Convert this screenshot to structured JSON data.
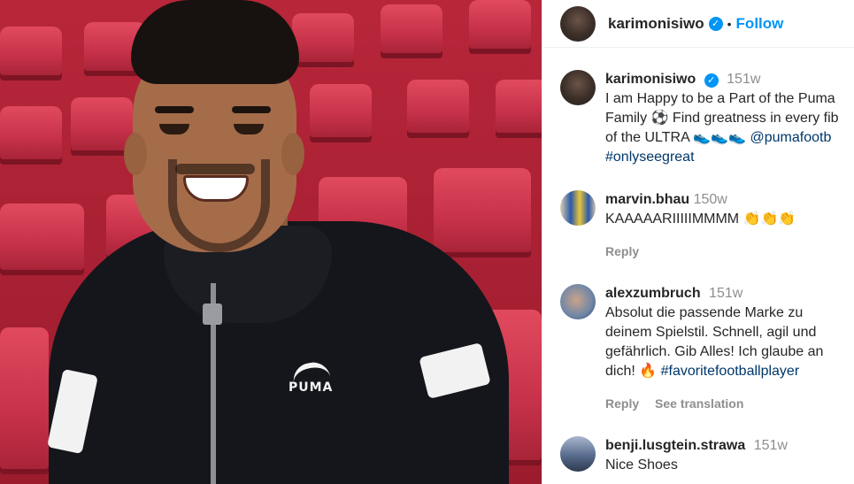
{
  "header": {
    "username": "karimonisiwo",
    "separator": "•",
    "follow_label": "Follow"
  },
  "caption": {
    "username": "karimonisiwo",
    "time": "151w",
    "line1": "I am Happy to be a Part of the Puma",
    "line2": "Family ⚽ Find greatness in every fib",
    "line3_text": "of the ULTRA 👟👟👟 ",
    "line3_link": "@pumafootb",
    "line4_link": "#onlyseegreat"
  },
  "comments": [
    {
      "username": "marvin.bhau",
      "time": "150w",
      "text": "KAAAAARIIIIIMMMM 👏👏👏",
      "reply_label": "Reply"
    },
    {
      "username": "alexzumbruch",
      "time": "151w",
      "line1": "Absolut die passende Marke zu",
      "line2": "deinem Spielstil. Schnell, agil und",
      "line3": "gefährlich. Gib Alles! Ich glaube an",
      "line4_text": "dich! 🔥 ",
      "line4_link": "#favoritefootballplayer",
      "reply_label": "Reply",
      "translate_label": "See translation"
    },
    {
      "username": "benji.lusgtein.strawa",
      "time": "151w",
      "text": "Nice Shoes"
    }
  ],
  "photo": {
    "logo_text": "PUMA"
  },
  "colors": {
    "accent": "#0095f6",
    "link": "#00376b",
    "muted": "#8e8e8e",
    "seat_red": "#c7324a"
  }
}
